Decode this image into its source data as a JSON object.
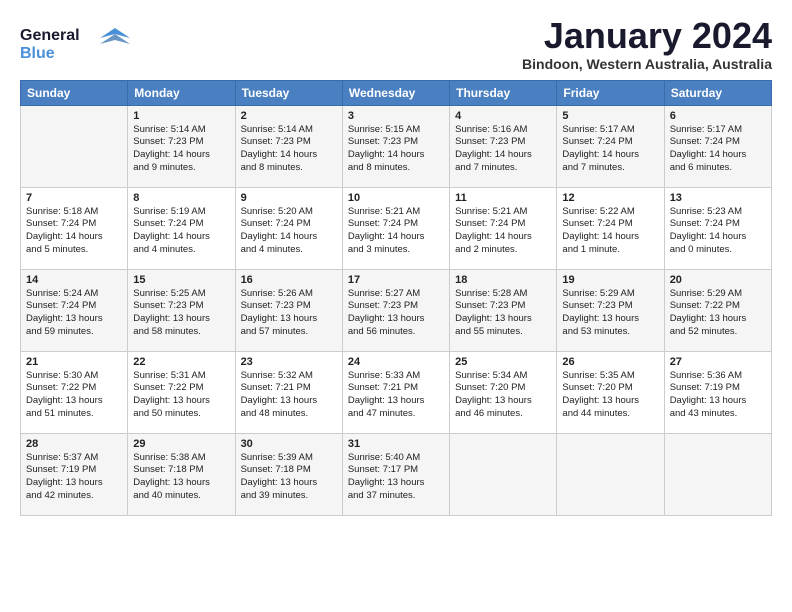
{
  "header": {
    "logo_line1": "General",
    "logo_line2": "Blue",
    "title": "January 2024",
    "subtitle": "Bindoon, Western Australia, Australia"
  },
  "days_of_week": [
    "Sunday",
    "Monday",
    "Tuesday",
    "Wednesday",
    "Thursday",
    "Friday",
    "Saturday"
  ],
  "weeks": [
    [
      {
        "day": "",
        "info": ""
      },
      {
        "day": "1",
        "info": "Sunrise: 5:14 AM\nSunset: 7:23 PM\nDaylight: 14 hours\nand 9 minutes."
      },
      {
        "day": "2",
        "info": "Sunrise: 5:14 AM\nSunset: 7:23 PM\nDaylight: 14 hours\nand 8 minutes."
      },
      {
        "day": "3",
        "info": "Sunrise: 5:15 AM\nSunset: 7:23 PM\nDaylight: 14 hours\nand 8 minutes."
      },
      {
        "day": "4",
        "info": "Sunrise: 5:16 AM\nSunset: 7:23 PM\nDaylight: 14 hours\nand 7 minutes."
      },
      {
        "day": "5",
        "info": "Sunrise: 5:17 AM\nSunset: 7:24 PM\nDaylight: 14 hours\nand 7 minutes."
      },
      {
        "day": "6",
        "info": "Sunrise: 5:17 AM\nSunset: 7:24 PM\nDaylight: 14 hours\nand 6 minutes."
      }
    ],
    [
      {
        "day": "7",
        "info": "Sunrise: 5:18 AM\nSunset: 7:24 PM\nDaylight: 14 hours\nand 5 minutes."
      },
      {
        "day": "8",
        "info": "Sunrise: 5:19 AM\nSunset: 7:24 PM\nDaylight: 14 hours\nand 4 minutes."
      },
      {
        "day": "9",
        "info": "Sunrise: 5:20 AM\nSunset: 7:24 PM\nDaylight: 14 hours\nand 4 minutes."
      },
      {
        "day": "10",
        "info": "Sunrise: 5:21 AM\nSunset: 7:24 PM\nDaylight: 14 hours\nand 3 minutes."
      },
      {
        "day": "11",
        "info": "Sunrise: 5:21 AM\nSunset: 7:24 PM\nDaylight: 14 hours\nand 2 minutes."
      },
      {
        "day": "12",
        "info": "Sunrise: 5:22 AM\nSunset: 7:24 PM\nDaylight: 14 hours\nand 1 minute."
      },
      {
        "day": "13",
        "info": "Sunrise: 5:23 AM\nSunset: 7:24 PM\nDaylight: 14 hours\nand 0 minutes."
      }
    ],
    [
      {
        "day": "14",
        "info": "Sunrise: 5:24 AM\nSunset: 7:24 PM\nDaylight: 13 hours\nand 59 minutes."
      },
      {
        "day": "15",
        "info": "Sunrise: 5:25 AM\nSunset: 7:23 PM\nDaylight: 13 hours\nand 58 minutes."
      },
      {
        "day": "16",
        "info": "Sunrise: 5:26 AM\nSunset: 7:23 PM\nDaylight: 13 hours\nand 57 minutes."
      },
      {
        "day": "17",
        "info": "Sunrise: 5:27 AM\nSunset: 7:23 PM\nDaylight: 13 hours\nand 56 minutes."
      },
      {
        "day": "18",
        "info": "Sunrise: 5:28 AM\nSunset: 7:23 PM\nDaylight: 13 hours\nand 55 minutes."
      },
      {
        "day": "19",
        "info": "Sunrise: 5:29 AM\nSunset: 7:23 PM\nDaylight: 13 hours\nand 53 minutes."
      },
      {
        "day": "20",
        "info": "Sunrise: 5:29 AM\nSunset: 7:22 PM\nDaylight: 13 hours\nand 52 minutes."
      }
    ],
    [
      {
        "day": "21",
        "info": "Sunrise: 5:30 AM\nSunset: 7:22 PM\nDaylight: 13 hours\nand 51 minutes."
      },
      {
        "day": "22",
        "info": "Sunrise: 5:31 AM\nSunset: 7:22 PM\nDaylight: 13 hours\nand 50 minutes."
      },
      {
        "day": "23",
        "info": "Sunrise: 5:32 AM\nSunset: 7:21 PM\nDaylight: 13 hours\nand 48 minutes."
      },
      {
        "day": "24",
        "info": "Sunrise: 5:33 AM\nSunset: 7:21 PM\nDaylight: 13 hours\nand 47 minutes."
      },
      {
        "day": "25",
        "info": "Sunrise: 5:34 AM\nSunset: 7:20 PM\nDaylight: 13 hours\nand 46 minutes."
      },
      {
        "day": "26",
        "info": "Sunrise: 5:35 AM\nSunset: 7:20 PM\nDaylight: 13 hours\nand 44 minutes."
      },
      {
        "day": "27",
        "info": "Sunrise: 5:36 AM\nSunset: 7:19 PM\nDaylight: 13 hours\nand 43 minutes."
      }
    ],
    [
      {
        "day": "28",
        "info": "Sunrise: 5:37 AM\nSunset: 7:19 PM\nDaylight: 13 hours\nand 42 minutes."
      },
      {
        "day": "29",
        "info": "Sunrise: 5:38 AM\nSunset: 7:18 PM\nDaylight: 13 hours\nand 40 minutes."
      },
      {
        "day": "30",
        "info": "Sunrise: 5:39 AM\nSunset: 7:18 PM\nDaylight: 13 hours\nand 39 minutes."
      },
      {
        "day": "31",
        "info": "Sunrise: 5:40 AM\nSunset: 7:17 PM\nDaylight: 13 hours\nand 37 minutes."
      },
      {
        "day": "",
        "info": ""
      },
      {
        "day": "",
        "info": ""
      },
      {
        "day": "",
        "info": ""
      }
    ]
  ]
}
